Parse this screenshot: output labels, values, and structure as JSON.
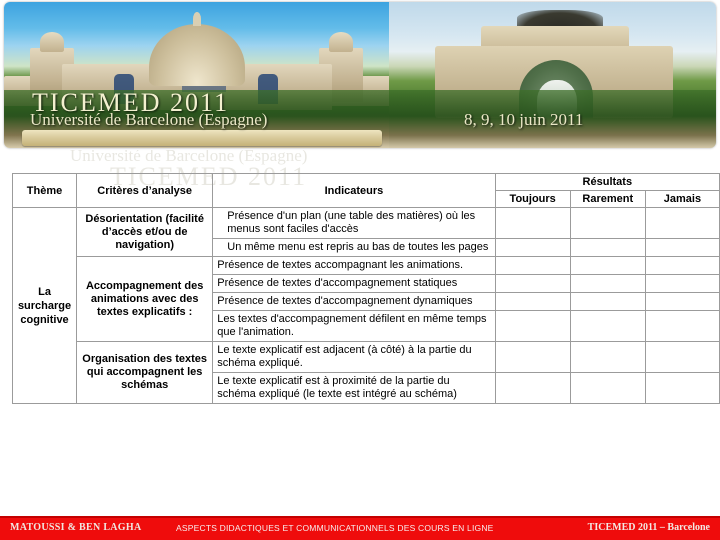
{
  "banner": {
    "title": "TICEMED 2011",
    "subtitle": "Université de Barcelone (Espagne)",
    "dates": "8, 9, 10 juin 2011",
    "ghost_line_1": "Université de Barcelone (Espagne)",
    "ghost_line_2": "TICEMED 2011"
  },
  "table": {
    "headers": {
      "theme": "Thème",
      "criteria": "Critères d’analyse",
      "indicators": "Indicateurs",
      "results": "Résultats",
      "always": "Toujours",
      "rarely": "Rarement",
      "never": "Jamais"
    },
    "theme_label": "La surcharge cognitive",
    "criteria": [
      {
        "label": "Désorientation (facilité d’accès et/ou de navigation)",
        "rowspan": 2
      },
      {
        "label": "Accompagnement des animations avec des textes explicatifs :",
        "rowspan": 4
      },
      {
        "label": "Organisation des textes qui accompagnent les schémas",
        "rowspan": 2
      }
    ],
    "indicators": [
      "Présence d'un plan (une table des matières) où les menus sont faciles d'accès",
      "Un même menu est repris au bas de toutes les pages",
      "Présence de textes accompagnant les animations.",
      "Présence de textes d'accompagnement statiques",
      "Présence de textes d'accompagnement dynamiques",
      "Les textes d'accompagnement défilent en même temps que l'animation.",
      "Le texte explicatif est adjacent (à côté) à la partie du schéma expliqué.",
      "Le texte explicatif est à proximité de la partie du schéma expliqué (le texte est intégré au schéma)"
    ],
    "results_cells": [
      [
        "",
        "",
        ""
      ],
      [
        "",
        "",
        ""
      ],
      [
        "",
        "",
        ""
      ],
      [
        "",
        "",
        ""
      ],
      [
        "",
        "",
        ""
      ],
      [
        "",
        "",
        ""
      ],
      [
        "",
        "",
        ""
      ],
      [
        "",
        "",
        ""
      ]
    ]
  },
  "footer": {
    "authors": "MATOUSSI & BEN LAGHA",
    "title": "ASPECTS DIDACTIQUES ET COMMUNICATIONNELS DES COURS EN LIGNE",
    "event": "TICEMED 2011 – Barcelone",
    "background_color": "#ef0c0c"
  }
}
